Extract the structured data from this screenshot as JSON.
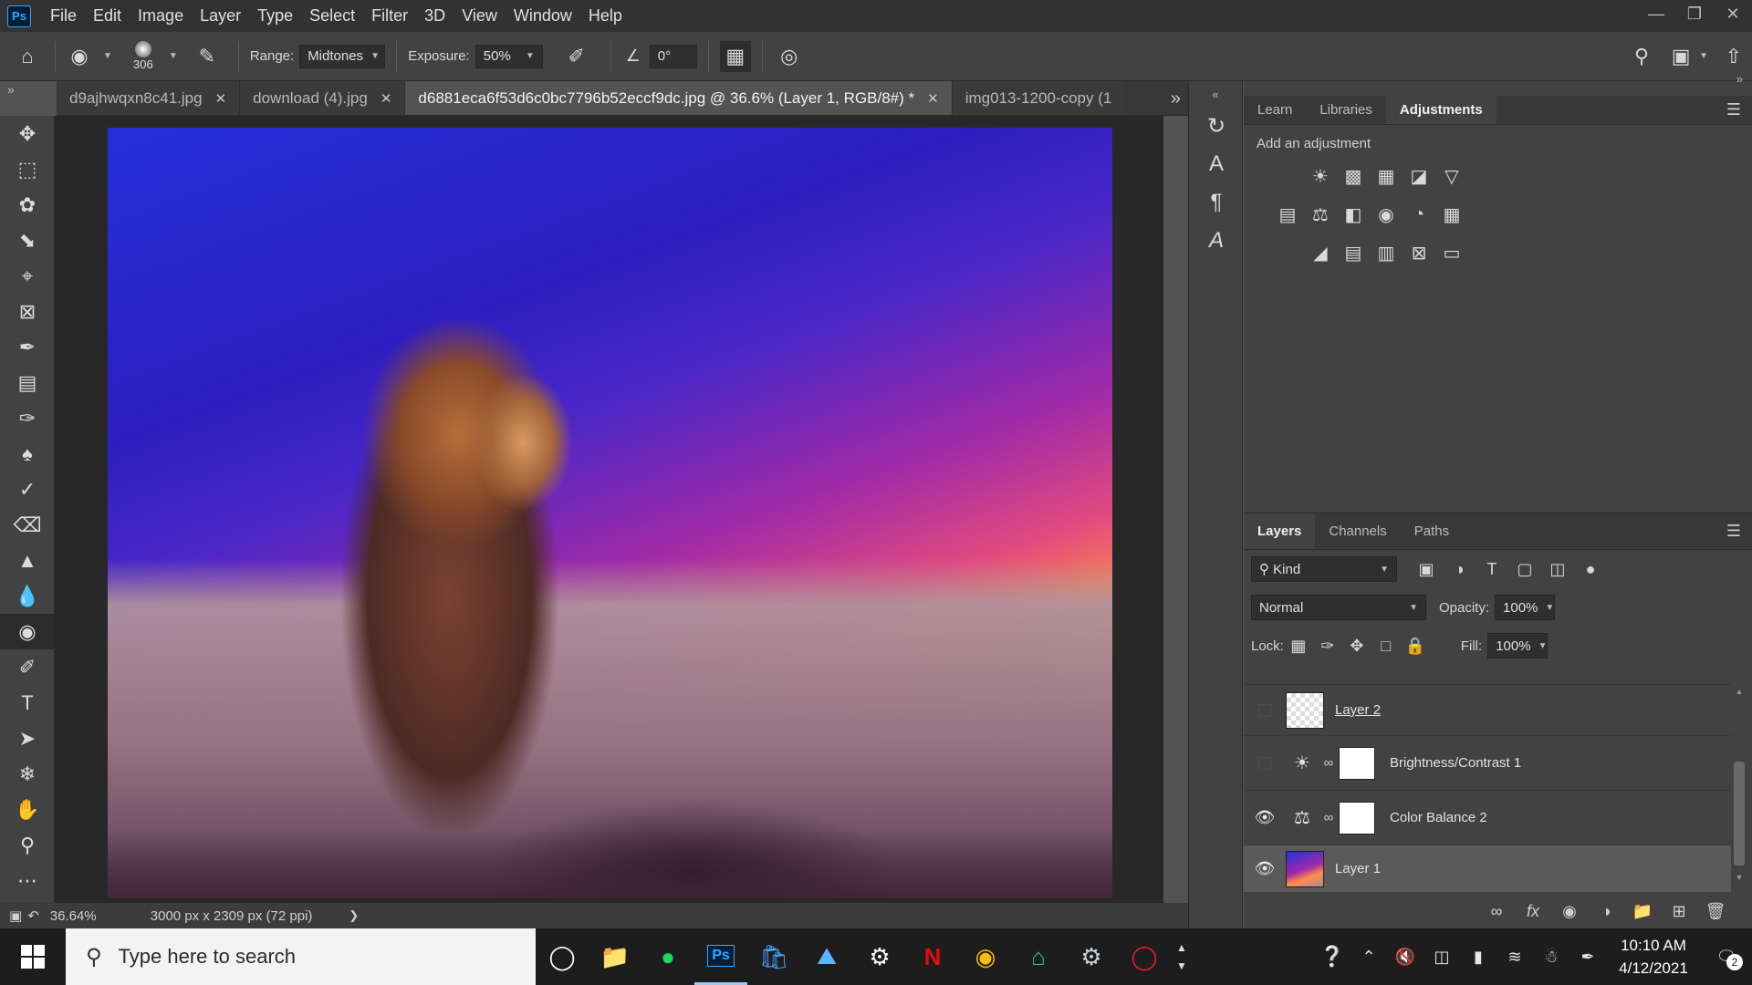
{
  "app": {
    "logo": "Ps",
    "menu": [
      "File",
      "Edit",
      "Image",
      "Layer",
      "Type",
      "Select",
      "Filter",
      "3D",
      "View",
      "Window",
      "Help"
    ]
  },
  "options": {
    "brush_size": "306",
    "range_label": "Range:",
    "range_value": "Midtones",
    "exposure_label": "Exposure:",
    "exposure_value": "50%",
    "angle_value": "0°"
  },
  "tabs": [
    {
      "label": "d9ajhwqxn8c41.jpg",
      "active": false
    },
    {
      "label": "download (4).jpg",
      "active": false
    },
    {
      "label": "d6881eca6f53d6c0bc7796b52eccf9dc.jpg @ 36.6% (Layer 1, RGB/8#) *",
      "active": true
    },
    {
      "label": "img013-1200-copy (1",
      "active": false
    }
  ],
  "status": {
    "zoom": "36.64%",
    "doc_info": "3000 px x 2309 px (72 ppi)"
  },
  "adjustments_panel": {
    "tabs": [
      "Learn",
      "Libraries",
      "Adjustments"
    ],
    "hint": "Add an adjustment"
  },
  "layers_panel": {
    "tabs": [
      "Layers",
      "Channels",
      "Paths"
    ],
    "kind_filter": "Kind",
    "blend_mode": "Normal",
    "opacity_label": "Opacity:",
    "opacity_value": "100%",
    "lock_label": "Lock:",
    "fill_label": "Fill:",
    "fill_value": "100%",
    "layers": [
      {
        "name": "Layer 2",
        "visible": false
      },
      {
        "name": "Brightness/Contrast 1",
        "visible": false
      },
      {
        "name": "Color Balance 2",
        "visible": true
      },
      {
        "name": "Layer 1",
        "visible": true,
        "selected": true
      }
    ]
  },
  "taskbar": {
    "search_placeholder": "Type here to search",
    "time": "10:10 AM",
    "date": "4/12/2021",
    "notification_count": "2"
  },
  "colors": {
    "accent": "#31a8ff",
    "panel_bg": "#424242",
    "canvas_bg": "#282828"
  }
}
